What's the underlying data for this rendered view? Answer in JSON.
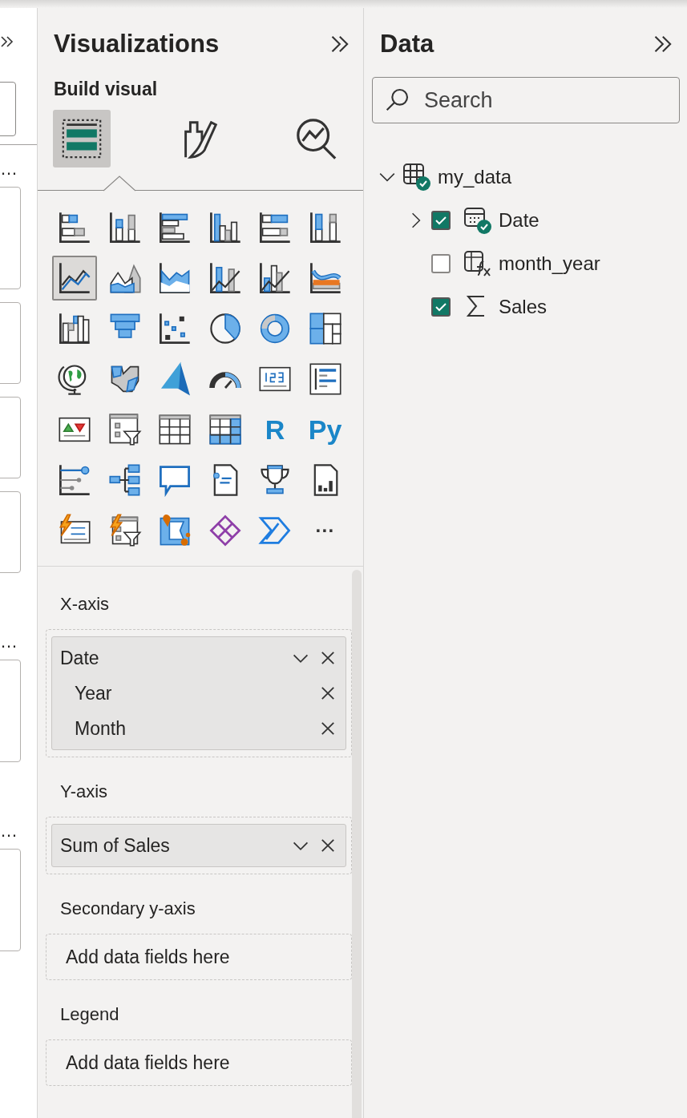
{
  "left_pane": {
    "more_labels": [
      "…",
      "…",
      "…"
    ]
  },
  "visualizations": {
    "title": "Visualizations",
    "pane_title": "Build visual",
    "tabs": [
      {
        "kind": "build",
        "selected": true
      },
      {
        "kind": "format",
        "selected": false
      },
      {
        "kind": "analytics",
        "selected": false
      }
    ],
    "visual_types": [
      {
        "kind": "stackedbar",
        "selected": false
      },
      {
        "kind": "stackedcolumn",
        "selected": false
      },
      {
        "kind": "clusteredbar",
        "selected": false
      },
      {
        "kind": "clusteredcolumn",
        "selected": false
      },
      {
        "kind": "pctbar",
        "selected": false
      },
      {
        "kind": "pctcolumn",
        "selected": false
      },
      {
        "kind": "line",
        "selected": true
      },
      {
        "kind": "area",
        "selected": false
      },
      {
        "kind": "stackedarea",
        "selected": false
      },
      {
        "kind": "linestacked",
        "selected": false
      },
      {
        "kind": "lineclustered",
        "selected": false
      },
      {
        "kind": "ribbon",
        "selected": false
      },
      {
        "kind": "waterfall",
        "selected": false
      },
      {
        "kind": "funnel",
        "selected": false
      },
      {
        "kind": "scatter",
        "selected": false
      },
      {
        "kind": "pie",
        "selected": false
      },
      {
        "kind": "donut",
        "selected": false
      },
      {
        "kind": "treemap",
        "selected": false
      },
      {
        "kind": "globe",
        "selected": false
      },
      {
        "kind": "filledmap",
        "selected": false
      },
      {
        "kind": "arrow",
        "selected": false
      },
      {
        "kind": "gauge",
        "selected": false
      },
      {
        "kind": "card",
        "selected": false
      },
      {
        "kind": "multicard",
        "selected": false
      },
      {
        "kind": "kpi",
        "selected": false
      },
      {
        "kind": "slicer",
        "selected": false
      },
      {
        "kind": "table",
        "selected": false
      },
      {
        "kind": "matrix",
        "selected": false
      },
      {
        "kind": "text",
        "label": "R",
        "selected": false
      },
      {
        "kind": "text",
        "label": "Py",
        "selected": false
      },
      {
        "kind": "influencers",
        "selected": false
      },
      {
        "kind": "tree",
        "selected": false
      },
      {
        "kind": "bubble",
        "selected": false
      },
      {
        "kind": "narrative",
        "selected": false
      },
      {
        "kind": "trophy",
        "selected": false
      },
      {
        "kind": "report",
        "selected": false
      },
      {
        "kind": "appscard",
        "selected": false
      },
      {
        "kind": "automateslicer",
        "selected": false
      },
      {
        "kind": "pinmap",
        "selected": false
      },
      {
        "kind": "diamond",
        "selected": false
      },
      {
        "kind": "chevrons",
        "selected": false
      },
      {
        "kind": "more",
        "label": "···",
        "selected": false
      }
    ],
    "wells": [
      {
        "label": "X-axis",
        "fields": [
          {
            "name": "Date",
            "children": [
              {
                "name": "Year"
              },
              {
                "name": "Month"
              }
            ]
          }
        ]
      },
      {
        "label": "Y-axis",
        "fields": [
          {
            "name": "Sum of Sales"
          }
        ]
      },
      {
        "label": "Secondary y-axis",
        "placeholder": "Add data fields here"
      },
      {
        "label": "Legend",
        "placeholder": "Add data fields here"
      }
    ]
  },
  "data": {
    "title": "Data",
    "search": {
      "placeholder": "Search"
    },
    "tables": [
      {
        "name": "my_data",
        "expanded": true,
        "in_use": true,
        "fields": [
          {
            "name": "Date",
            "kind": "date",
            "checked": true,
            "in_use": true,
            "expandable": true
          },
          {
            "name": "month_year",
            "kind": "calculated",
            "checked": false,
            "in_use": false,
            "expandable": false
          },
          {
            "name": "Sales",
            "kind": "sum",
            "checked": true,
            "in_use": false,
            "expandable": false
          }
        ]
      }
    ]
  }
}
